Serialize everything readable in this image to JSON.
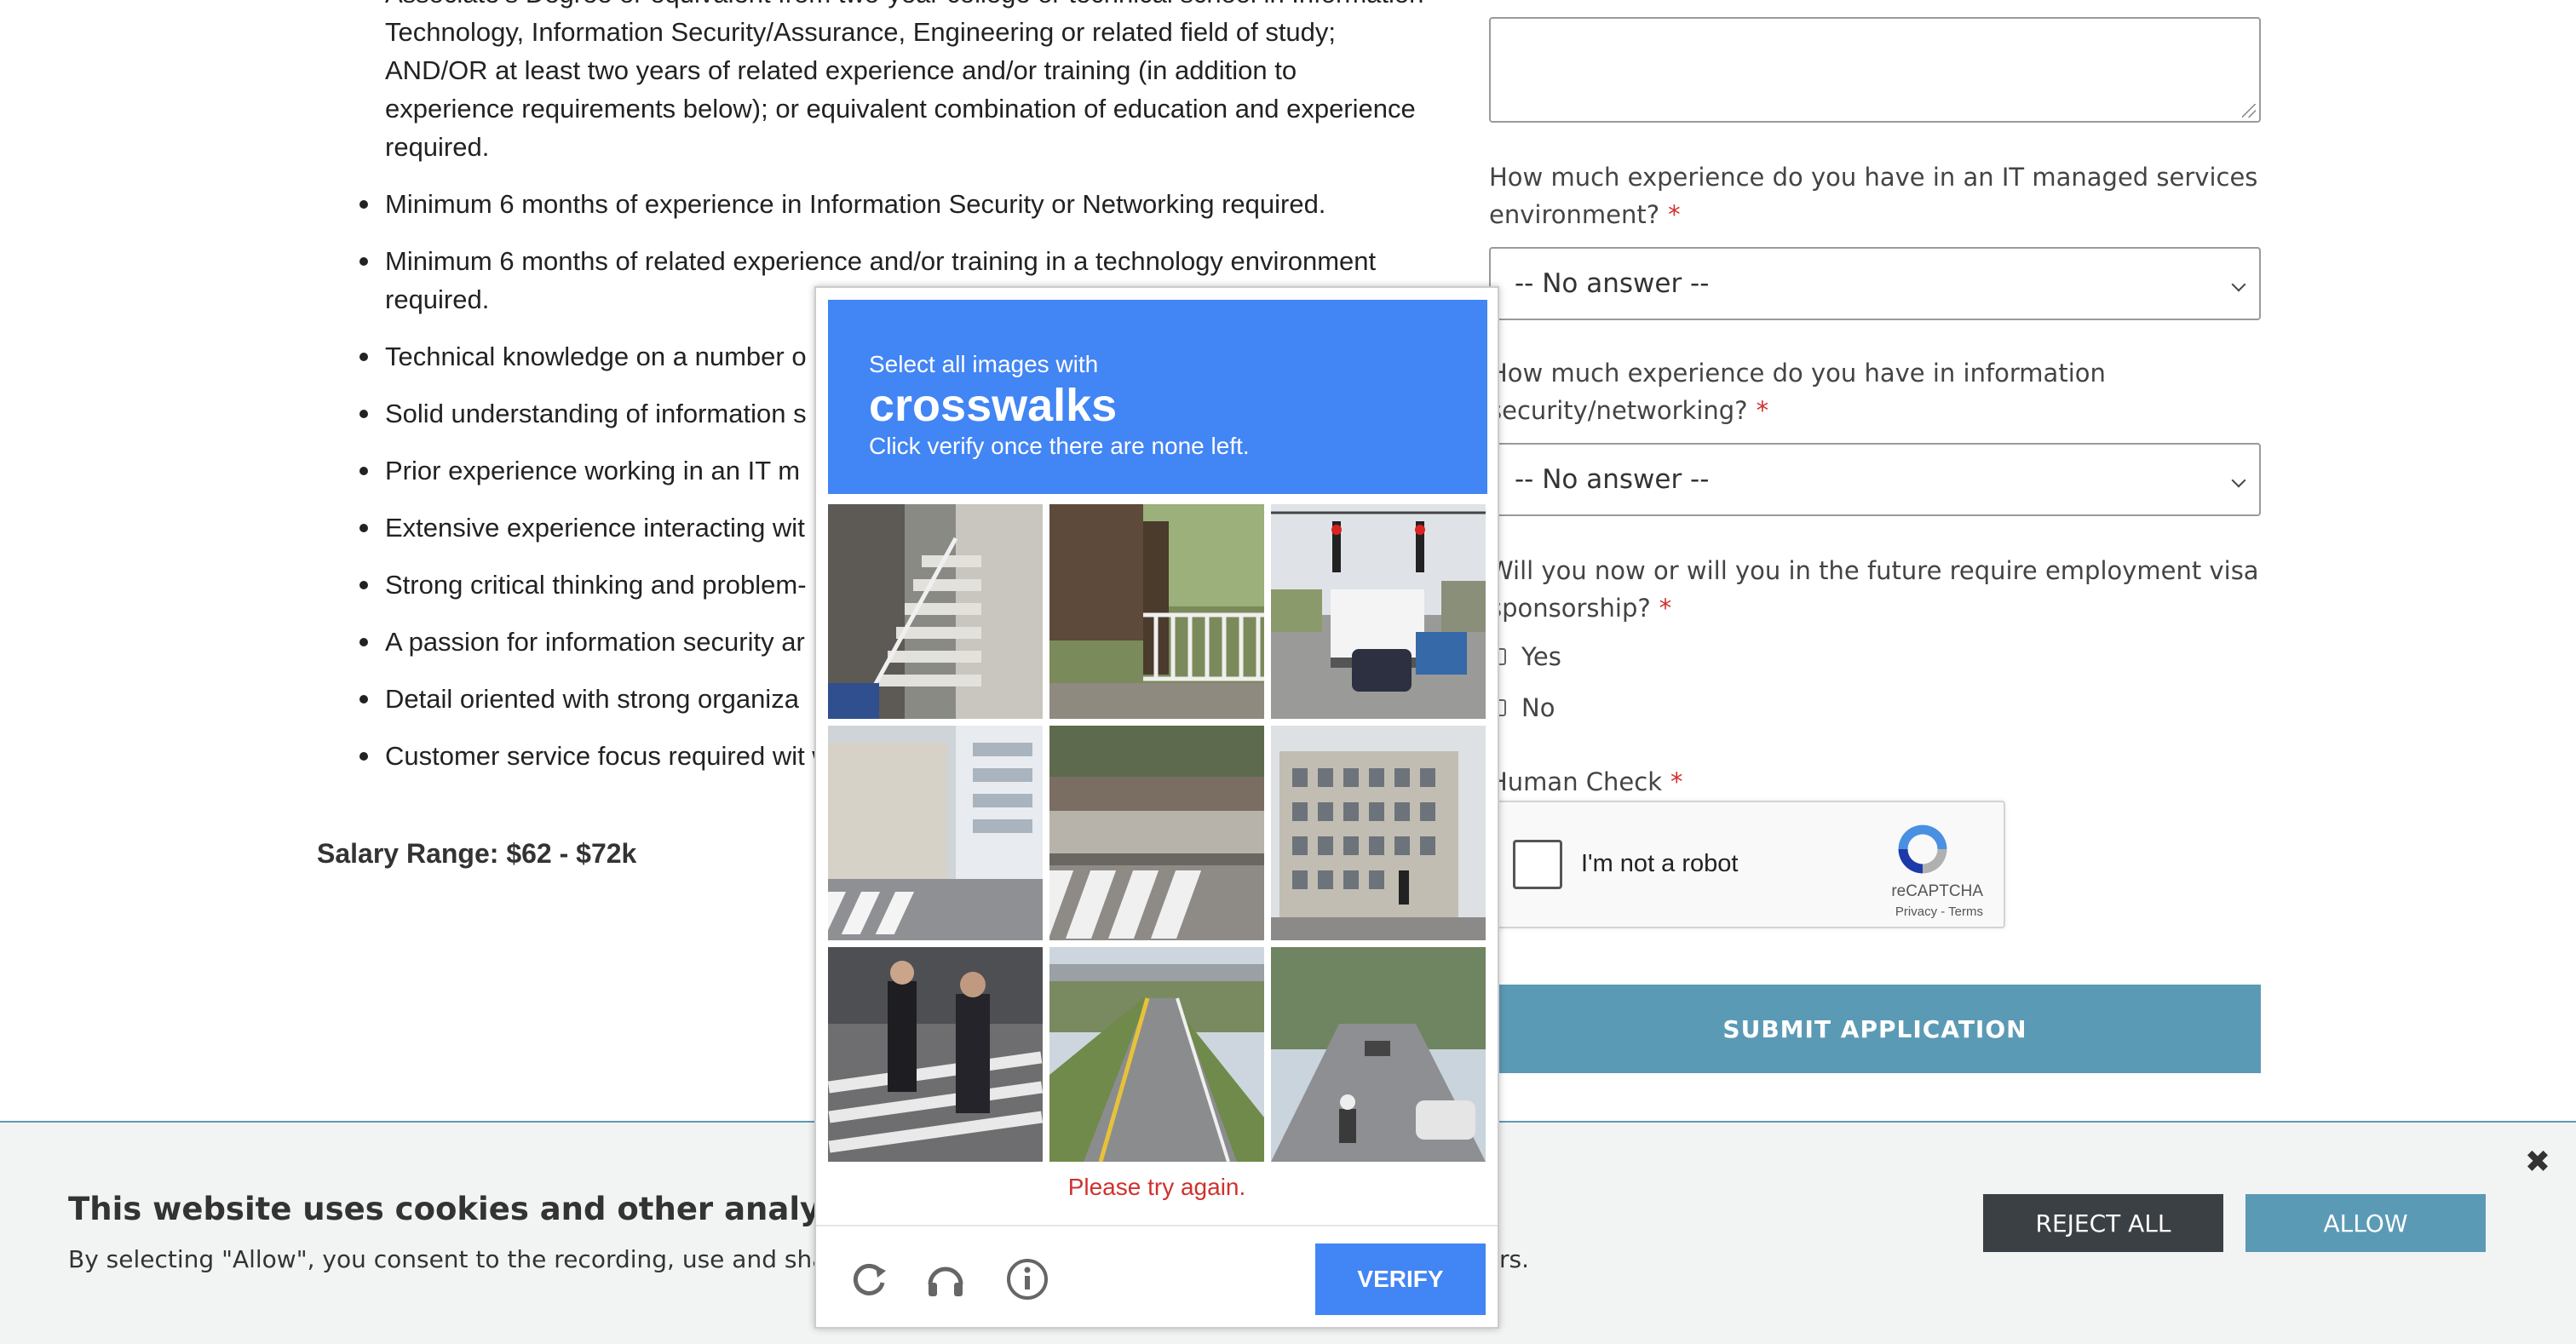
{
  "job": {
    "requirements": [
      "Associate’s Degree or equivalent from two-year college or technical school in Information Technology, Information Security/Assurance, Engineering or related field of study; AND/OR at least two years of related experience and/or training (in addition to experience requirements below); or equivalent combination of education and experience required.",
      "Minimum 6 months of experience in Information Security or Networking required.",
      "Minimum 6 months of related experience and/or training in a technology environment required.",
      "Technical knowledge on a number o",
      "Solid understanding of information s",
      "Prior experience working in an IT m",
      "Extensive experience interacting wit",
      "Strong critical thinking and problem-",
      "A passion for information security ar",
      "Detail oriented with strong organiza",
      "Customer service focus required wit written/verbal communication skills."
    ],
    "salary": "Salary Range: $62 - $72k"
  },
  "form": {
    "q_managed_services": "How much experience do you have in an IT managed services environment?",
    "q_infosec": "How much experience do you have in information security/networking?",
    "q_visa": "Will you now or will you in the future require employment visa sponsorship?",
    "required_mark": "*",
    "select_value": "-- No answer --",
    "visa_yes": "Yes",
    "visa_no": "No",
    "human_check": "Human Check",
    "recaptcha_label": "I'm not a robot",
    "recaptcha_brand": "reCAPTCHA",
    "recaptcha_terms": "Privacy - Terms",
    "submit_label": "SUBMIT APPLICATION"
  },
  "challenge": {
    "instruction": "Select all images with",
    "keyword": "crosswalks",
    "subtext": "Click verify once there are none left.",
    "error": "Please try again.",
    "verify_label": "VERIFY",
    "tiles": [
      "stairs",
      "fence-trees",
      "traffic-lights",
      "crosswalk-street",
      "crosswalk-sidewalk",
      "building",
      "crosswalk-people",
      "highway",
      "road-motorbike"
    ]
  },
  "cookie": {
    "title": "This website uses cookies and other analytics techn",
    "description": "By selecting \"Allow\", you consent to the recording, use and sharing",
    "description_tail": "rs.",
    "reject_label": "REJECT ALL",
    "allow_label": "ALLOW",
    "close_icon": "close-icon"
  },
  "colors": {
    "accent": "#5b9ab5",
    "captcha_blue": "#4285f4",
    "error_red": "#d0312d",
    "dark_button": "#3b4044"
  }
}
